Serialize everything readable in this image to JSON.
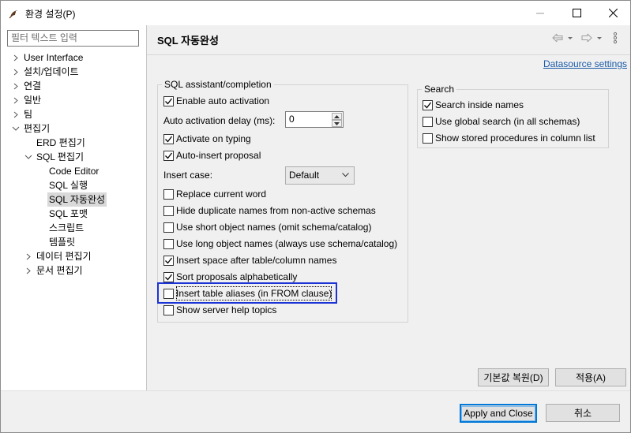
{
  "window": {
    "title": "환경 설정(P)"
  },
  "nav": {
    "filter_placeholder": "필터 텍스트 입력",
    "items": [
      {
        "label": "User Interface"
      },
      {
        "label": "설치/업데이트"
      },
      {
        "label": "연결"
      },
      {
        "label": "일반"
      },
      {
        "label": "팀"
      },
      {
        "label": "편집기"
      },
      {
        "label": "ERD 편집기"
      },
      {
        "label": "SQL 편집기"
      },
      {
        "label": "Code Editor"
      },
      {
        "label": "SQL 실행"
      },
      {
        "label": "SQL 자동완성"
      },
      {
        "label": "SQL 포맷"
      },
      {
        "label": "스크립트"
      },
      {
        "label": "템플릿"
      },
      {
        "label": "데이터 편집기"
      },
      {
        "label": "문서 편집기"
      }
    ]
  },
  "page": {
    "title": "SQL 자동완성",
    "datasource_link": "Datasource settings"
  },
  "assist": {
    "legend": "SQL assistant/completion",
    "enable_auto_activation": "Enable auto activation",
    "delay_label": "Auto activation delay (ms):",
    "delay_value": "0",
    "activate_on_typing": "Activate on typing",
    "auto_insert": "Auto-insert proposal",
    "insert_case_label": "Insert case:",
    "insert_case_value": "Default",
    "replace_word": "Replace current word",
    "hide_duplicates": "Hide duplicate names from non-active schemas",
    "short_names": "Use short object names (omit schema/catalog)",
    "long_names": "Use long object names (always use schema/catalog)",
    "insert_space": "Insert space after table/column names",
    "sort_alpha": "Sort proposals alphabetically",
    "insert_aliases": "Insert table aliases (in FROM clause)",
    "server_help": "Show server help topics"
  },
  "search": {
    "legend": "Search",
    "inside_names": "Search inside names",
    "global_search": "Use global search (in all schemas)",
    "stored_procs": "Show stored procedures in column list"
  },
  "buttons": {
    "restore_defaults": "기본값 복원(D)",
    "apply": "적용(A)",
    "apply_close": "Apply and Close",
    "cancel": "취소"
  },
  "colors": {
    "focus_rect": "#1c33d6",
    "link": "#1a5aa8"
  }
}
